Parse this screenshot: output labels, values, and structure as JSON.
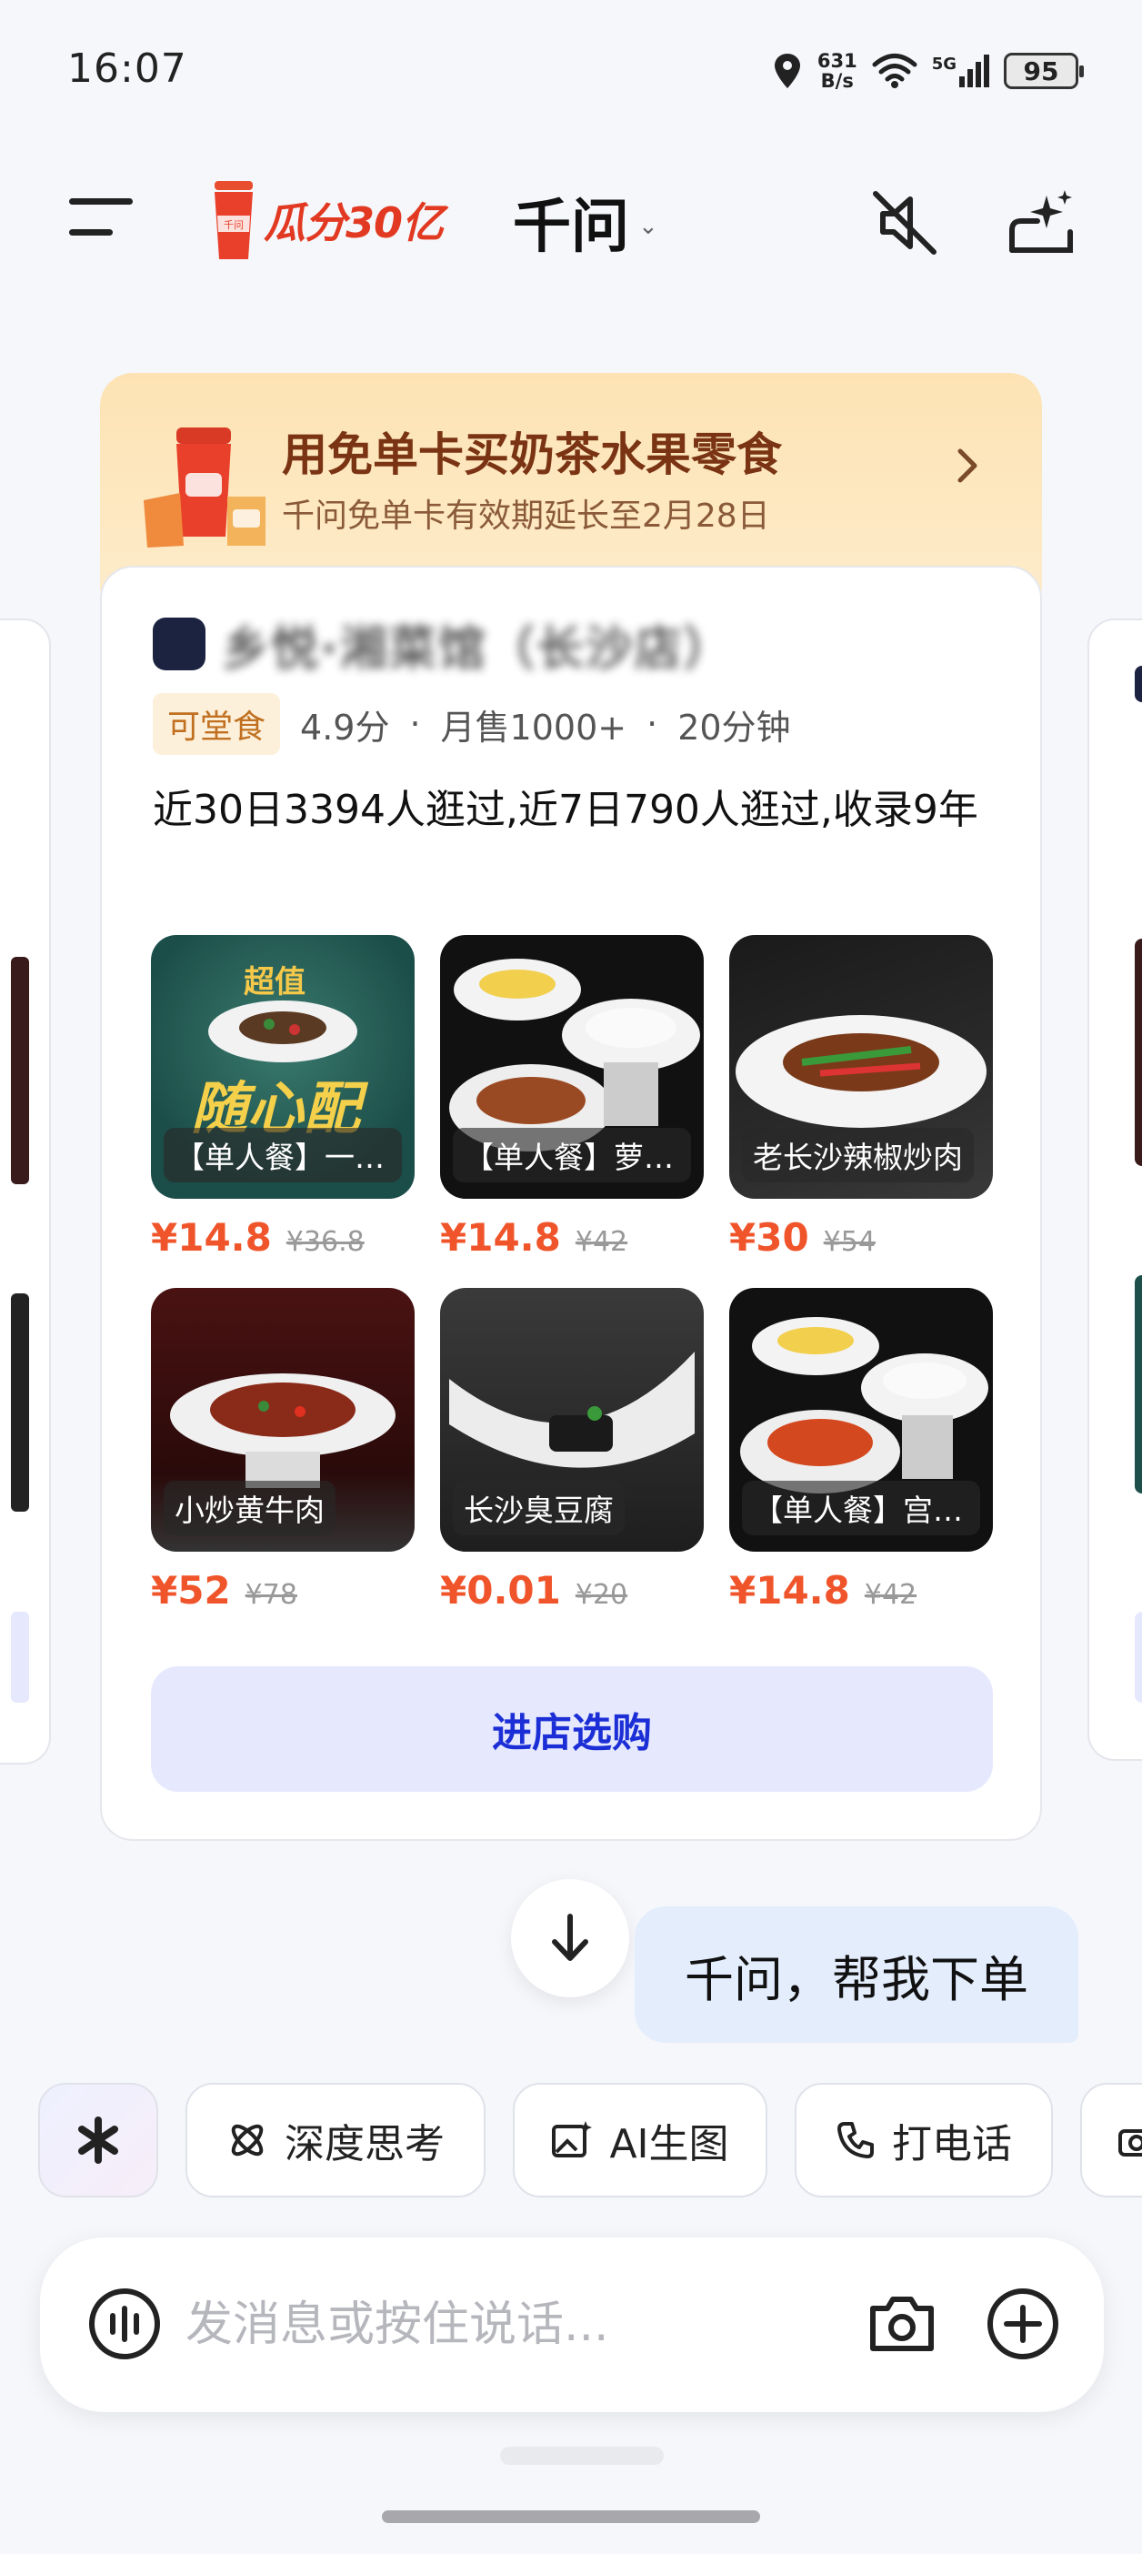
{
  "status_bar": {
    "time": "16:07",
    "net_speed_value": "631",
    "net_speed_unit": "B/s",
    "network_label": "5G",
    "battery": "95"
  },
  "header": {
    "promo_text": "瓜分30亿",
    "title": "千问",
    "menu_icon": "menu-icon",
    "mute_icon": "mute-icon",
    "new_chat_icon": "new-chat-icon"
  },
  "banner": {
    "title": "用免单卡买奶茶水果零食",
    "subtitle": "千问免单卡有效期延长至2月28日"
  },
  "store": {
    "name": "乡悦·湘菜馆（长沙店）",
    "tag": "可堂食",
    "rating": "4.9分",
    "sales": "月售1000+",
    "delivery_time": "20分钟",
    "visits": "近30日3394人逛过,近7日790人逛过,收录9年"
  },
  "products": [
    {
      "name": "【单人餐】一荤一素套餐",
      "price": "¥14.8",
      "old_price": "¥36.8",
      "overlay_title": "超值",
      "overlay_main": "随心配"
    },
    {
      "name": "【单人餐】萝卜干炒肉饭",
      "price": "¥14.8",
      "old_price": "¥42"
    },
    {
      "name": "老长沙辣椒炒肉",
      "price": "¥30",
      "old_price": "¥54"
    },
    {
      "name": "小炒黄牛肉",
      "price": "¥52",
      "old_price": "¥78"
    },
    {
      "name": "长沙臭豆腐",
      "price": "¥0.01",
      "old_price": "¥20"
    },
    {
      "name": "【单人餐】宫保鸡丁饭",
      "price": "¥14.8",
      "old_price": "¥42"
    }
  ],
  "shop_button": "进店选购",
  "message": "千问，帮我下单",
  "chips": [
    "深度思考",
    "AI生图",
    "打电话"
  ],
  "input": {
    "placeholder": "发消息或按住说话..."
  },
  "colors": {
    "accent_blue": "#1c2fd6",
    "price_red": "#f0542a",
    "banner_brown": "#7a3414"
  }
}
